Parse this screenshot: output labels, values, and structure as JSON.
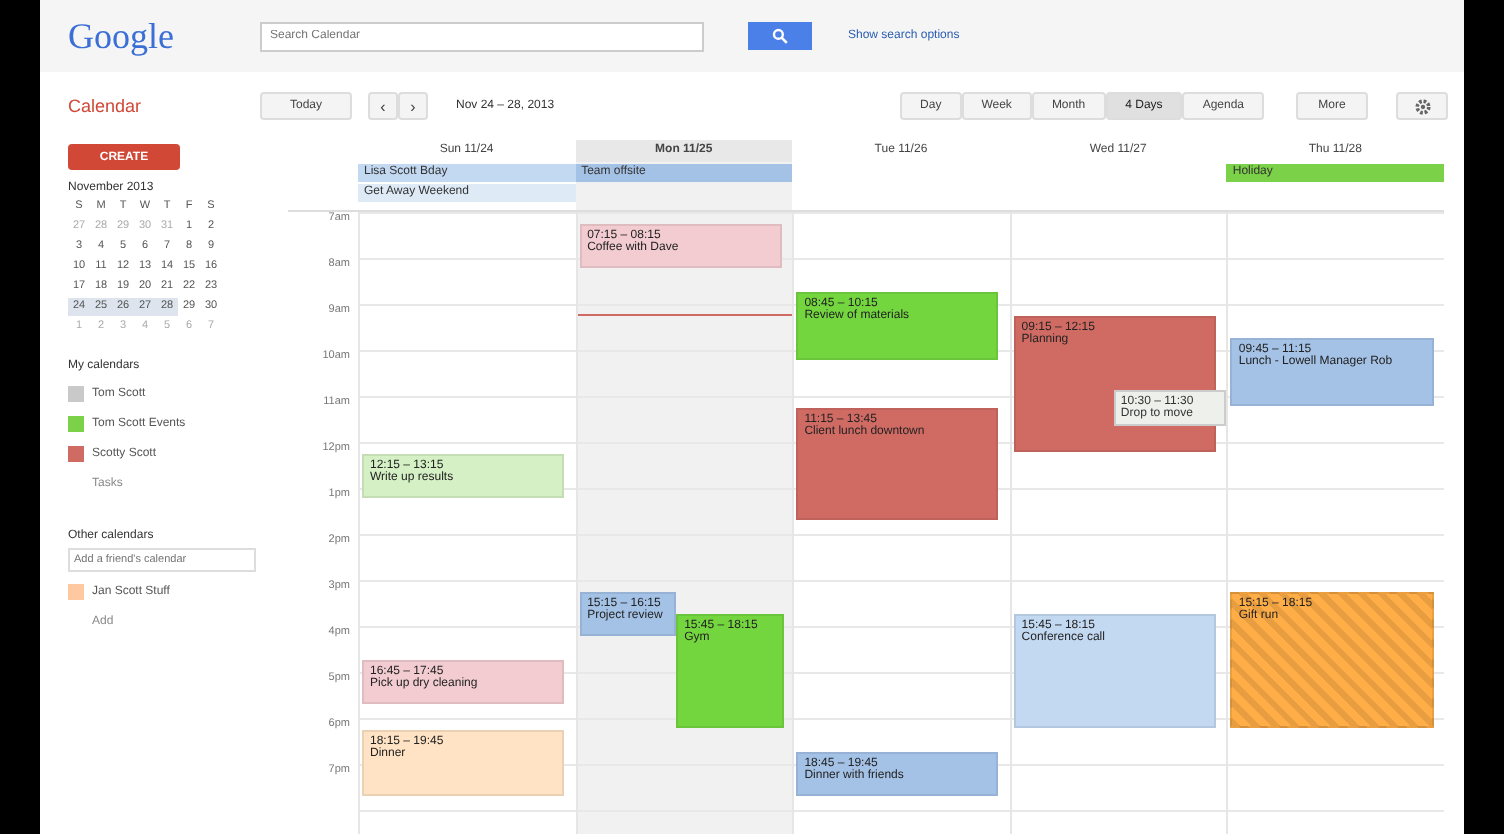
{
  "header": {
    "logo": "Google",
    "search": {
      "placeholder": "Search Calendar"
    },
    "link": "Show search options"
  },
  "toolbar": {
    "app_title": "Calendar",
    "today": "Today",
    "prev": "‹",
    "next": "›",
    "date_range": "Nov 24 – 28, 2013",
    "views": [
      {
        "label": "Day",
        "selected": false
      },
      {
        "label": "Week",
        "selected": false
      },
      {
        "label": "Month",
        "selected": false
      },
      {
        "label": "4 Days",
        "selected": true
      },
      {
        "label": "Agenda",
        "selected": false
      }
    ],
    "more": "More"
  },
  "sidebar": {
    "create": "CREATE",
    "mini_calendar": {
      "title": "November 2013",
      "weekdays": [
        "S",
        "M",
        "T",
        "W",
        "T",
        "F",
        "S"
      ],
      "weeks": [
        [
          {
            "d": "27",
            "other": true,
            "selected": false
          },
          {
            "d": "28",
            "other": true,
            "selected": false
          },
          {
            "d": "29",
            "other": true,
            "selected": false
          },
          {
            "d": "30",
            "other": true,
            "selected": false
          },
          {
            "d": "31",
            "other": true,
            "selected": false
          },
          {
            "d": "1",
            "other": false,
            "selected": false
          },
          {
            "d": "2",
            "other": false,
            "selected": false
          }
        ],
        [
          {
            "d": "3",
            "other": false,
            "selected": false
          },
          {
            "d": "4",
            "other": false,
            "selected": false
          },
          {
            "d": "5",
            "other": false,
            "selected": false
          },
          {
            "d": "6",
            "other": false,
            "selected": false
          },
          {
            "d": "7",
            "other": false,
            "selected": false
          },
          {
            "d": "8",
            "other": false,
            "selected": false
          },
          {
            "d": "9",
            "other": false,
            "selected": false
          }
        ],
        [
          {
            "d": "10",
            "other": false,
            "selected": false
          },
          {
            "d": "11",
            "other": false,
            "selected": false
          },
          {
            "d": "12",
            "other": false,
            "selected": false
          },
          {
            "d": "13",
            "other": false,
            "selected": false
          },
          {
            "d": "14",
            "other": false,
            "selected": false
          },
          {
            "d": "15",
            "other": false,
            "selected": false
          },
          {
            "d": "16",
            "other": false,
            "selected": false
          }
        ],
        [
          {
            "d": "17",
            "other": false,
            "selected": false
          },
          {
            "d": "18",
            "other": false,
            "selected": false
          },
          {
            "d": "19",
            "other": false,
            "selected": false
          },
          {
            "d": "20",
            "other": false,
            "selected": false
          },
          {
            "d": "21",
            "other": false,
            "selected": false
          },
          {
            "d": "22",
            "other": false,
            "selected": false
          },
          {
            "d": "23",
            "other": false,
            "selected": false
          }
        ],
        [
          {
            "d": "24",
            "other": false,
            "selected": true
          },
          {
            "d": "25",
            "other": false,
            "selected": true
          },
          {
            "d": "26",
            "other": false,
            "selected": true
          },
          {
            "d": "27",
            "other": false,
            "selected": true
          },
          {
            "d": "28",
            "other": false,
            "selected": true
          },
          {
            "d": "29",
            "other": false,
            "selected": false
          },
          {
            "d": "30",
            "other": false,
            "selected": false
          }
        ],
        [
          {
            "d": "1",
            "other": true,
            "selected": false
          },
          {
            "d": "2",
            "other": true,
            "selected": false
          },
          {
            "d": "3",
            "other": true,
            "selected": false
          },
          {
            "d": "4",
            "other": true,
            "selected": false
          },
          {
            "d": "5",
            "other": true,
            "selected": false
          },
          {
            "d": "6",
            "other": true,
            "selected": false
          },
          {
            "d": "7",
            "other": true,
            "selected": false
          }
        ]
      ]
    },
    "my_calendars": {
      "title": "My calendars",
      "items": [
        {
          "label": "Tom Scott",
          "color": "#c9c9c9"
        },
        {
          "label": "Tom Scott Events",
          "color": "#7bd148"
        },
        {
          "label": "Scotty Scott",
          "color": "#d06b64"
        },
        {
          "label": "Tasks"
        }
      ]
    },
    "other_calendars": {
      "title": "Other calendars",
      "placeholder": "Add a friend's calendar",
      "items": [
        {
          "label": "Jan Scott Stuff",
          "color": "#ffc8a0"
        },
        {
          "label": "Add"
        }
      ]
    }
  },
  "grid": {
    "hours": [
      "7am",
      "8am",
      "9am",
      "10am",
      "11am",
      "12pm",
      "1pm",
      "2pm",
      "3pm",
      "4pm",
      "5pm",
      "6pm",
      "7pm"
    ],
    "days": [
      {
        "label": "Sun 11/24",
        "today": false,
        "allday": [
          {
            "title": "Lisa Scott Bday",
            "color": "#c3d9f2"
          },
          {
            "title": "Get Away Weekend",
            "color": "#dfeaf7"
          }
        ],
        "events": [
          {
            "time": "12:15 – 13:15",
            "title": "Write up results",
            "color": "#d5f0c4",
            "shifted": false,
            "striped": false
          },
          {
            "time": "16:45 – 17:45",
            "title": "Pick up dry cleaning",
            "color": "#f2ccd0",
            "shifted": false,
            "striped": false
          },
          {
            "time": "18:15 – 19:45",
            "title": "Dinner",
            "color": "#ffe3c4",
            "shifted": false,
            "striped": false
          }
        ]
      },
      {
        "label": "Mon 11/25",
        "today": true,
        "allday": [
          {
            "title": "Team offsite",
            "color": "#a4c2e6"
          }
        ],
        "events": [
          {
            "time": "07:15 – 08:15",
            "title": "Coffee with Dave",
            "color": "#f2ccd0",
            "shifted": false,
            "striped": false
          },
          {
            "time": "15:15 – 16:15",
            "title": "Project review",
            "color": "#a4c2e6",
            "shifted": false,
            "striped": false
          },
          {
            "time": "15:45 – 18:15",
            "title": "Gym",
            "color": "#74d63f",
            "shifted": true,
            "striped": false
          }
        ]
      },
      {
        "label": "Tue 11/26",
        "today": false,
        "events": [
          {
            "time": "08:45 – 10:15",
            "title": "Review of materials",
            "color": "#74d63f",
            "shifted": false,
            "striped": false
          },
          {
            "time": "11:15 – 13:45",
            "title": "Client lunch downtown",
            "color": "#d06b64",
            "shifted": false,
            "striped": false
          },
          {
            "time": "18:45 – 19:45",
            "title": "Dinner with friends",
            "color": "#a4c2e6",
            "shifted": false,
            "striped": false
          }
        ]
      },
      {
        "label": "Wed 11/27",
        "today": false,
        "events": [
          {
            "time": "09:15 – 12:15",
            "title": "Planning",
            "color": "#d06b64",
            "shifted": false,
            "striped": false
          },
          {
            "time": "15:45 – 18:15",
            "title": "Conference call",
            "color": "#c3d9f2",
            "shifted": false,
            "striped": false
          }
        ]
      },
      {
        "label": "Thu 11/28",
        "today": false,
        "allday": [
          {
            "title": "Holiday",
            "color": "#7bd148"
          }
        ],
        "events": [
          {
            "time": "09:45 – 11:15",
            "title": "Lunch - Lowell Manager Rob",
            "color": "#a4c2e6",
            "shifted": false,
            "striped": false
          },
          {
            "time": "15:15 – 18:15",
            "title": "Gift run",
            "color": "#ffad46",
            "shifted": false,
            "striped": true
          }
        ]
      }
    ],
    "tooltip": {
      "time": "10:30 – 11:30",
      "text": "Drop to move"
    }
  }
}
